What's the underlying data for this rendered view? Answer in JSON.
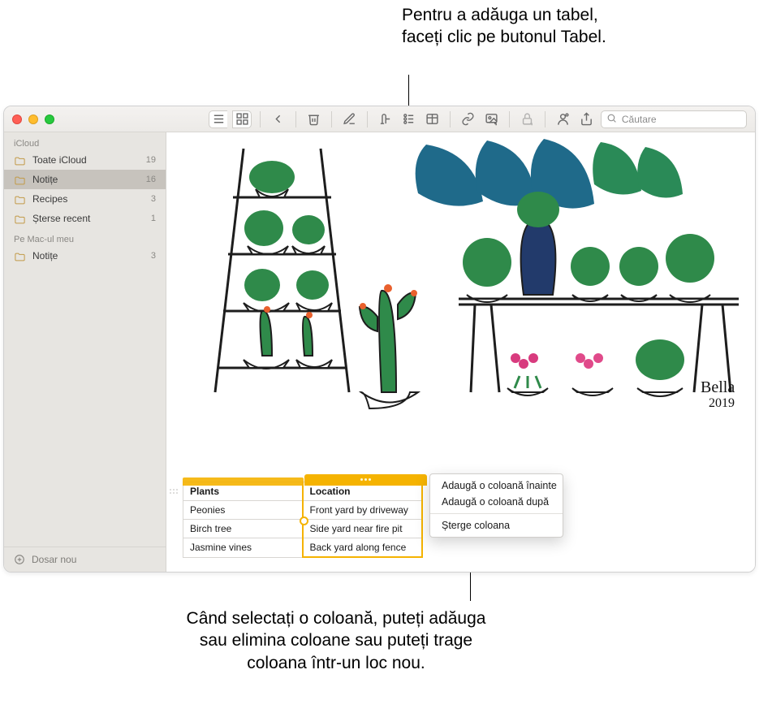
{
  "callouts": {
    "top": "Pentru a adăuga un tabel, faceți clic pe butonul Tabel.",
    "bottom": "Când selectați o coloană, puteți adăuga sau elimina coloane sau puteți trage coloana într-un loc nou."
  },
  "search_placeholder": "Căutare",
  "sidebar": {
    "groups": [
      {
        "header": "iCloud",
        "items": [
          {
            "label": "Toate iCloud",
            "count": "19"
          },
          {
            "label": "Notițe",
            "count": "16",
            "active": true
          },
          {
            "label": "Recipes",
            "count": "3"
          },
          {
            "label": "Șterse recent",
            "count": "1"
          }
        ]
      },
      {
        "header": "Pe Mac-ul meu",
        "items": [
          {
            "label": "Notițe",
            "count": "3"
          }
        ]
      }
    ],
    "footer_label": "Dosar nou"
  },
  "signature": {
    "name": "Bella",
    "year": "2019"
  },
  "table": {
    "headers": [
      "Plants",
      "Location"
    ],
    "rows": [
      [
        "Peonies",
        "Front yard by driveway"
      ],
      [
        "Birch tree",
        "Side yard near fire pit"
      ],
      [
        "Jasmine vines",
        "Back yard along fence"
      ]
    ]
  },
  "context_menu": {
    "items": [
      "Adaugă o coloană înainte",
      "Adaugă o coloană după"
    ],
    "after_sep": [
      "Șterge coloana"
    ]
  }
}
